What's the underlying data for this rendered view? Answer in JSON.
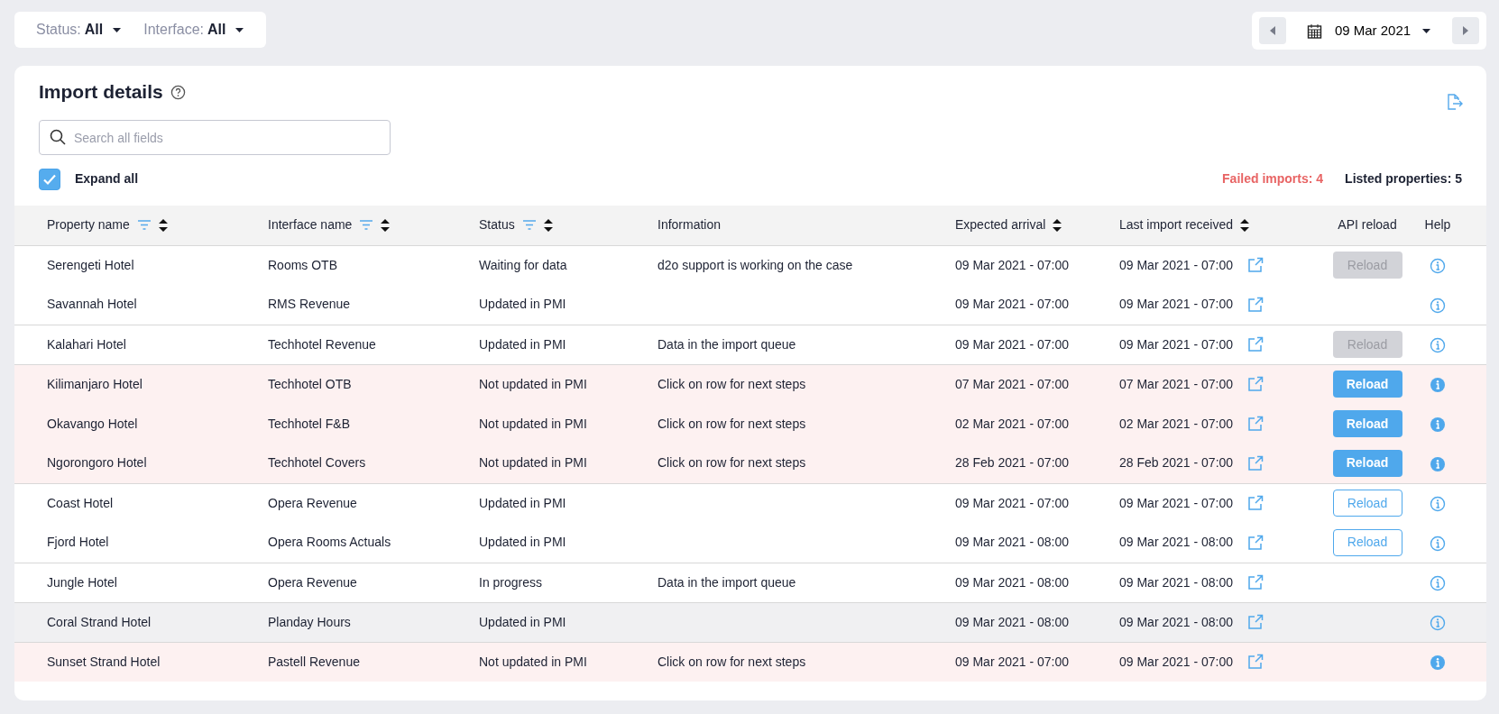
{
  "filters": [
    {
      "label": "Status:",
      "value": "All"
    },
    {
      "label": "Interface:",
      "value": "All"
    }
  ],
  "date_picker": {
    "value": "09 Mar 2021"
  },
  "panel": {
    "title": "Import details",
    "search": {
      "placeholder": "Search all fields"
    },
    "expand_all": {
      "label": "Expand all",
      "checked": true
    },
    "failed_imports": "Failed imports: 4",
    "listed_properties": "Listed properties: 5"
  },
  "table": {
    "columns": [
      {
        "label": "Property name",
        "filter": true,
        "sort": true
      },
      {
        "label": "Interface name",
        "filter": true,
        "sort": true
      },
      {
        "label": "Status",
        "filter": true,
        "sort": true
      },
      {
        "label": "Information",
        "filter": false,
        "sort": false
      },
      {
        "label": "Expected arrival",
        "filter": false,
        "sort": true
      },
      {
        "label": "Last import received",
        "filter": false,
        "sort": true
      },
      {
        "label": "API reload",
        "filter": false,
        "sort": false
      },
      {
        "label": "Help",
        "filter": false,
        "sort": false
      }
    ],
    "groups": [
      {
        "rows": [
          {
            "property": "Serengeti Hotel",
            "interface": "Rooms OTB",
            "status": "Waiting for data",
            "information": "d2o support is working on the case",
            "expected": "09 Mar 2021 - 07:00",
            "last_import": "09 Mar 2021 - 07:00",
            "reload": {
              "label": "Reload",
              "kind": "disabled"
            },
            "failed": false,
            "hovered": false
          },
          {
            "property": "Savannah Hotel",
            "interface": "RMS Revenue",
            "status": "Updated in PMI",
            "expected": "09 Mar 2021 - 07:00",
            "last_import": "09 Mar 2021 - 07:00",
            "failed": false,
            "hovered": false
          }
        ]
      },
      {
        "rows": [
          {
            "property": "Kalahari Hotel",
            "interface": "Techhotel Revenue",
            "status": "Updated in PMI",
            "information": "Data in the import queue",
            "expected": "09 Mar 2021 - 07:00",
            "last_import": "09 Mar 2021 - 07:00",
            "reload": {
              "label": "Reload",
              "kind": "disabled"
            },
            "failed": false,
            "hovered": false
          }
        ]
      },
      {
        "rows": [
          {
            "property": "Kilimanjaro Hotel",
            "interface": "Techhotel OTB",
            "status": "Not updated in PMI",
            "information": "Click on row for next steps",
            "expected": "07 Mar 2021 - 07:00",
            "last_import": "07 Mar 2021 - 07:00",
            "reload": {
              "label": "Reload",
              "kind": "primary"
            },
            "failed": true,
            "hovered": false
          },
          {
            "property": "Okavango Hotel",
            "interface": "Techhotel F&B",
            "status": "Not updated in PMI",
            "information": "Click on row for next steps",
            "expected": "02 Mar 2021 - 07:00",
            "last_import": "02 Mar 2021 - 07:00",
            "reload": {
              "label": "Reload",
              "kind": "primary"
            },
            "failed": true,
            "hovered": false
          },
          {
            "property": "Ngorongoro Hotel",
            "interface": "Techhotel Covers",
            "status": "Not updated in PMI",
            "information": "Click on row for next steps",
            "expected": "28 Feb 2021 - 07:00",
            "last_import": "28 Feb 2021 - 07:00",
            "reload": {
              "label": "Reload",
              "kind": "primary"
            },
            "failed": true,
            "hovered": false
          }
        ]
      },
      {
        "rows": [
          {
            "property": "Coast Hotel",
            "interface": "Opera Revenue",
            "status": "Updated in PMI",
            "expected": "09 Mar 2021 - 07:00",
            "last_import": "09 Mar 2021 - 07:00",
            "reload": {
              "label": "Reload",
              "kind": "outline"
            },
            "failed": false,
            "hovered": false
          },
          {
            "property": "Fjord Hotel",
            "interface": "Opera Rooms Actuals",
            "status": "Updated in PMI",
            "expected": "09 Mar 2021 - 08:00",
            "last_import": "09 Mar 2021 - 08:00",
            "reload": {
              "label": "Reload",
              "kind": "outline"
            },
            "failed": false,
            "hovered": false
          }
        ]
      },
      {
        "rows": [
          {
            "property": "Jungle Hotel",
            "interface": "Opera Revenue",
            "status": "In progress",
            "information": "Data in the import queue",
            "expected": "09 Mar 2021 - 08:00",
            "last_import": "09 Mar 2021 - 08:00",
            "failed": false,
            "hovered": false
          }
        ]
      },
      {
        "rows": [
          {
            "property": "Coral Strand Hotel",
            "interface": "Planday Hours",
            "status": "Updated in PMI",
            "expected": "09 Mar 2021 - 08:00",
            "last_import": "09 Mar 2021 - 08:00",
            "failed": false,
            "hovered": true
          }
        ]
      },
      {
        "rows": [
          {
            "property": "Sunset Strand Hotel",
            "interface": "Pastell Revenue",
            "status": "Not updated in PMI",
            "information": "Click on row for next steps",
            "expected": "09 Mar 2021 - 07:00",
            "last_import": "09 Mar 2021 - 07:00",
            "failed": true,
            "hovered": false
          }
        ]
      }
    ]
  }
}
